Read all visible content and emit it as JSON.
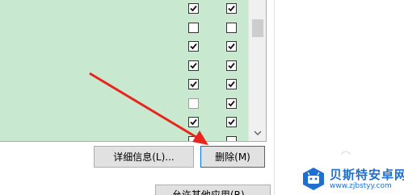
{
  "list": {
    "rows": [
      {
        "col1": "checked",
        "col2": "checked"
      },
      {
        "col1": "unchecked",
        "col2": "unchecked"
      },
      {
        "col1": "checked",
        "col2": "checked"
      },
      {
        "col1": "checked",
        "col2": "checked"
      },
      {
        "col1": "checked",
        "col2": "checked"
      },
      {
        "col1": "unchecked-disabled",
        "col2": "checked"
      },
      {
        "col1": "checked",
        "col2": "checked"
      },
      {
        "col1": "unchecked",
        "col2": "unchecked"
      }
    ],
    "background_color": "#c8e8d0"
  },
  "buttons": {
    "details_label": "详细信息(L)...",
    "delete_label": "删除(M)",
    "allow_other_label": "允许其他应用(R)..."
  },
  "annotation": {
    "arrow_color": "#e8261e",
    "arrow_target": "delete-button"
  },
  "watermark": {
    "title": "贝斯特安卓网",
    "url": "www.zjbstyy.com",
    "brand_color": "#1d6fd1"
  },
  "icons": {
    "scroll_down": "chevron-down-icon",
    "checkbox_checked": "checkmark-icon"
  }
}
